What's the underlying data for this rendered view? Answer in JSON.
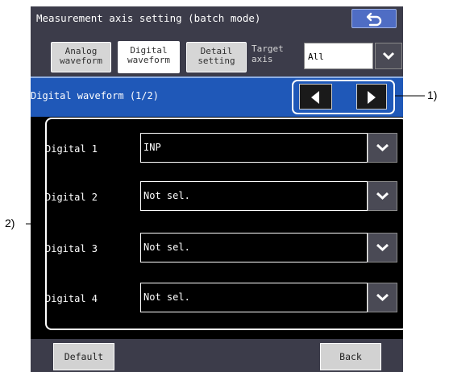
{
  "header": {
    "title": "Measurement axis setting (batch mode)",
    "back_icon": "return-arrow-icon"
  },
  "tabs": [
    {
      "line1": "Analog",
      "line2": "waveform",
      "active": false
    },
    {
      "line1": "Digital",
      "line2": "waveform",
      "active": true
    },
    {
      "line1": "Detail",
      "line2": "setting",
      "active": false
    }
  ],
  "target_axis": {
    "label_line1": "Target",
    "label_line2": "axis",
    "value": "All"
  },
  "section": {
    "title": "Digital waveform (1/2)",
    "prev_icon": "triangle-left-icon",
    "next_icon": "triangle-right-icon"
  },
  "rows": [
    {
      "label": "Digital 1",
      "value": "INP"
    },
    {
      "label": "Digital 2",
      "value": "Not sel."
    },
    {
      "label": "Digital 3",
      "value": "Not sel."
    },
    {
      "label": "Digital 4",
      "value": "Not sel."
    }
  ],
  "footer": {
    "default_label": "Default",
    "back_label": "Back"
  },
  "callouts": {
    "nav": "1)",
    "rows": "2)"
  },
  "colors": {
    "accent_blue": "#1f58b8",
    "panel_bg": "#000000",
    "bar_bg": "#3c3c4a",
    "button_blue": "#4f6dc4"
  }
}
